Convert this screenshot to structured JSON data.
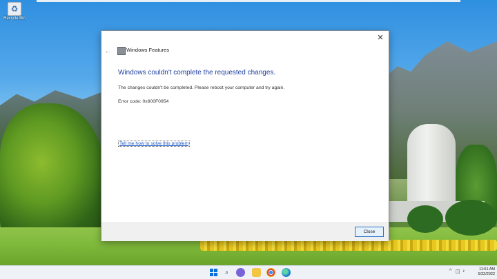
{
  "desktop": {
    "recycle_bin_label": "Recycle Bin"
  },
  "dialog": {
    "title": "Windows Features",
    "heading": "Windows couldn't complete the requested changes.",
    "message": "The changes couldn't be completed. Please reboot your computer and try again.",
    "error_code": "Error code: 0x800F0954",
    "help_link": "Tell me how to solve this problem",
    "close_button_label": "Close",
    "close_glyph": "✕",
    "back_glyph": "←"
  },
  "taskbar": {
    "icons": [
      "start-icon",
      "search-icon",
      "chat-icon",
      "file-explorer-icon",
      "chrome-icon",
      "edge-icon"
    ],
    "tray_caret": "^",
    "clock_time": "11:51 AM",
    "clock_date": "5/22/2022"
  },
  "colors": {
    "heading": "#1e3f9e",
    "link": "#1a56c4",
    "button_border": "#2c72c7"
  }
}
